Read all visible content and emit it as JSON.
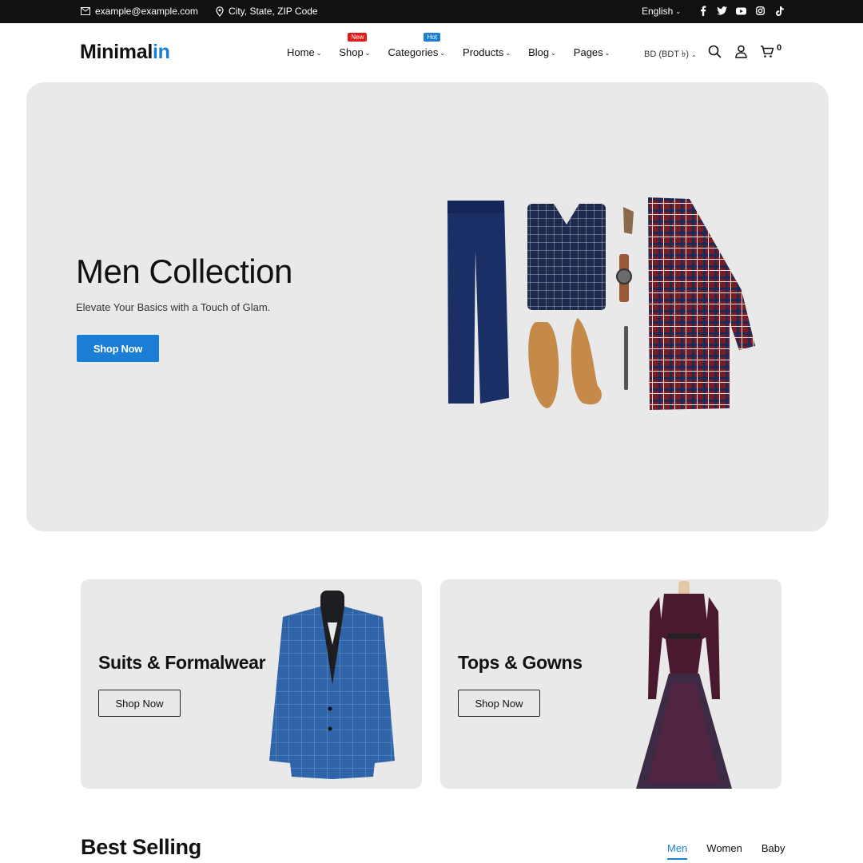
{
  "topbar": {
    "email": "example@example.com",
    "address": "City, State, ZIP Code",
    "language": "English",
    "socials": [
      "facebook-icon",
      "twitter-icon",
      "youtube-icon",
      "instagram-icon",
      "tiktok-icon"
    ]
  },
  "header": {
    "logo_main": "Minimal",
    "logo_accent": "in",
    "nav": [
      {
        "label": "Home",
        "badge": ""
      },
      {
        "label": "Shop",
        "badge": "New"
      },
      {
        "label": "Categories",
        "badge": "Hot"
      },
      {
        "label": "Products",
        "badge": ""
      },
      {
        "label": "Blog",
        "badge": ""
      },
      {
        "label": "Pages",
        "badge": ""
      }
    ],
    "currency": "BD (BDT ৳)",
    "cart_count": "0"
  },
  "hero": {
    "title": "Men Collection",
    "subtitle": "Elevate Your Basics with a Touch of Glam.",
    "button": "Shop Now"
  },
  "cards": [
    {
      "title": "Suits & Formalwear",
      "button": "Shop Now"
    },
    {
      "title": "Tops & Gowns",
      "button": "Shop Now"
    }
  ],
  "best_selling": {
    "title": "Best Selling",
    "tabs": [
      "Men",
      "Women",
      "Baby"
    ],
    "active_tab": "Men"
  },
  "colors": {
    "accent": "#1a7fd4",
    "topbar_bg": "#111111",
    "panel_bg": "#e9e9e9",
    "badge_new": "#e41a1a",
    "badge_hot": "#1a7fd4"
  }
}
